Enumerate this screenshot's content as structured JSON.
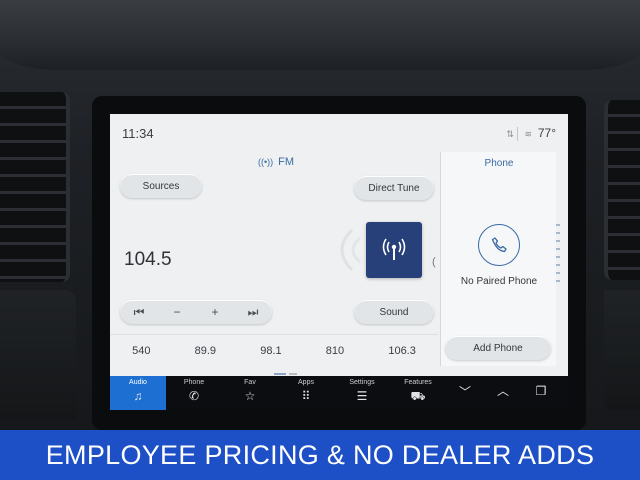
{
  "status": {
    "time": "11:34",
    "temperature": "77°"
  },
  "radio": {
    "band": "FM",
    "sources_label": "Sources",
    "direct_tune_label": "Direct Tune",
    "frequency": "104.5",
    "sound_label": "Sound",
    "seek_back_symbol": "⏮",
    "minus_symbol": "−",
    "plus_symbol": "+",
    "seek_forward_symbol": "⏭",
    "presets": [
      "540",
      "89.9",
      "98.1",
      "810",
      "106.3"
    ]
  },
  "phone": {
    "title": "Phone",
    "status": "No Paired Phone",
    "add_label": "Add Phone"
  },
  "nav": {
    "audio": "Audio",
    "phone": "Phone",
    "fav": "Fav",
    "apps": "Apps",
    "settings": "Settings",
    "features": "Features",
    "icons": {
      "audio": "♫",
      "phone": "✆",
      "fav": "☆",
      "apps": "⠿",
      "settings": "☰",
      "features": "⛟",
      "chevron_down": "︿",
      "chevron_up": "︿",
      "copy": "❐"
    }
  },
  "colors": {
    "accent": "#1e6fd2",
    "banner": "#1d4fc6",
    "station_tile": "#27407a",
    "screen_bg": "#eef0f1"
  },
  "banner": {
    "text": "EMPLOYEE PRICING & NO DEALER ADDS"
  }
}
